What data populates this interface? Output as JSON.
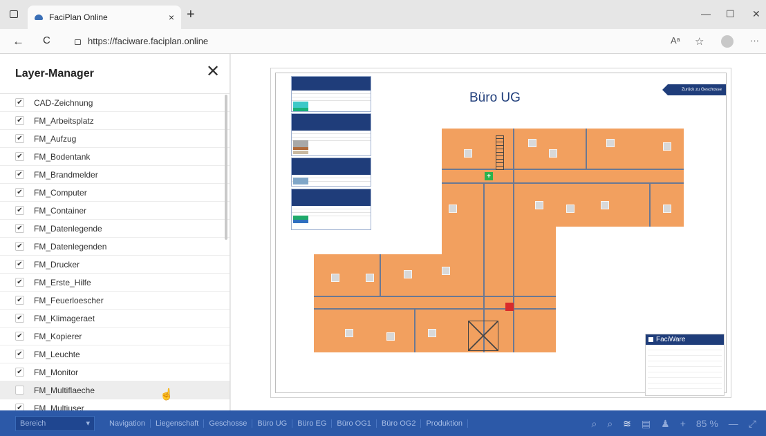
{
  "browser": {
    "tab_title": "FaciPlan Online",
    "url": "https://faciware.faciplan.online",
    "new_tab": "+",
    "close_tab": "×",
    "reader_icon": "Aᵃ",
    "fav_icon": "☆",
    "menu": "···",
    "minimize": "—",
    "maximize": "☐",
    "close_window": "✕",
    "back": "←",
    "reload": "C"
  },
  "layer_manager": {
    "title": "Layer-Manager",
    "close": "✕",
    "layers": [
      {
        "label": "CAD-Zeichnung",
        "checked": true
      },
      {
        "label": "FM_Arbeitsplatz",
        "checked": true
      },
      {
        "label": "FM_Aufzug",
        "checked": true
      },
      {
        "label": "FM_Bodentank",
        "checked": true
      },
      {
        "label": "FM_Brandmelder",
        "checked": true
      },
      {
        "label": "FM_Computer",
        "checked": true
      },
      {
        "label": "FM_Container",
        "checked": true
      },
      {
        "label": "FM_Datenlegende",
        "checked": true
      },
      {
        "label": "FM_Datenlegenden",
        "checked": true
      },
      {
        "label": "FM_Drucker",
        "checked": true
      },
      {
        "label": "FM_Erste_Hilfe",
        "checked": true
      },
      {
        "label": "FM_Feuerloescher",
        "checked": true
      },
      {
        "label": "FM_Klimageraet",
        "checked": true
      },
      {
        "label": "FM_Kopierer",
        "checked": true
      },
      {
        "label": "FM_Leuchte",
        "checked": true
      },
      {
        "label": "FM_Monitor",
        "checked": true
      },
      {
        "label": "FM_Multiflaeche",
        "checked": false
      },
      {
        "label": "FM_Multiuser",
        "checked": true
      }
    ]
  },
  "plan": {
    "title": "Büro UG",
    "back_button": "Zurück zu Geschosse",
    "logo_text": "FaciWare"
  },
  "bottombar": {
    "selector_value": "Bereich",
    "floors": [
      "Navigation",
      "Liegenschaft",
      "Geschosse",
      "Büro UG",
      "Büro EG",
      "Büro OG1",
      "Büro OG2",
      "Produktion"
    ],
    "tools": [
      "⌕",
      "⌕",
      "≋",
      "▤",
      "♟",
      "+",
      "85 %",
      "—",
      "⤢"
    ],
    "colors": {
      "bar": "#2c59a8",
      "accent": "#1f3d7a",
      "room": "#f2a05f"
    }
  }
}
